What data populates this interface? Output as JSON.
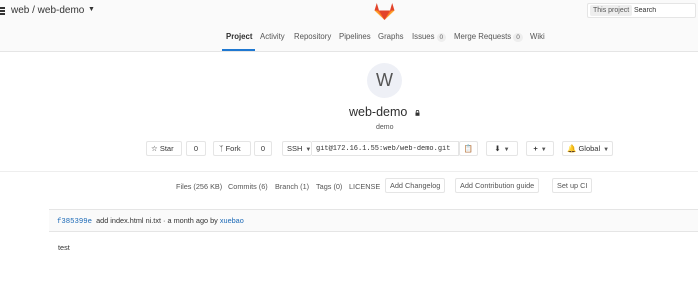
{
  "header": {
    "project_path": "web / web-demo",
    "search": {
      "scope": "This project",
      "placeholder": "Search"
    },
    "brand_color": "#fc6d26"
  },
  "nav": {
    "tabs": [
      {
        "label": "Project",
        "active": true
      },
      {
        "label": "Activity"
      },
      {
        "label": "Repository"
      },
      {
        "label": "Pipelines"
      },
      {
        "label": "Graphs"
      },
      {
        "label": "Issues",
        "count": "0"
      },
      {
        "label": "Merge Requests",
        "count": "0"
      },
      {
        "label": "Wiki"
      }
    ],
    "active_color": "#1f78d1"
  },
  "project": {
    "avatar_letter": "W",
    "name": "web-demo",
    "description": "demo"
  },
  "actions": {
    "star_label": "Star",
    "star_count": "0",
    "fork_label": "Fork",
    "fork_count": "0",
    "clone_protocol": "SSH",
    "clone_url": "git@172.16.1.55:web/web-demo.git",
    "notification_label": "Global"
  },
  "stats": {
    "files": "Files (256 KB)",
    "commits": "Commits (6)",
    "branches": "Branch (1)",
    "tags": "Tags (0)",
    "license": "LICENSE",
    "add_changelog": "Add Changelog",
    "add_contribution": "Add Contribution guide",
    "setup_ci": "Set up CI"
  },
  "last_commit": {
    "sha": "f385399e",
    "message": "add index.html ni.txt",
    "time": "a month ago",
    "by": "by",
    "author": "xuebao"
  },
  "readme": {
    "text": "test"
  }
}
